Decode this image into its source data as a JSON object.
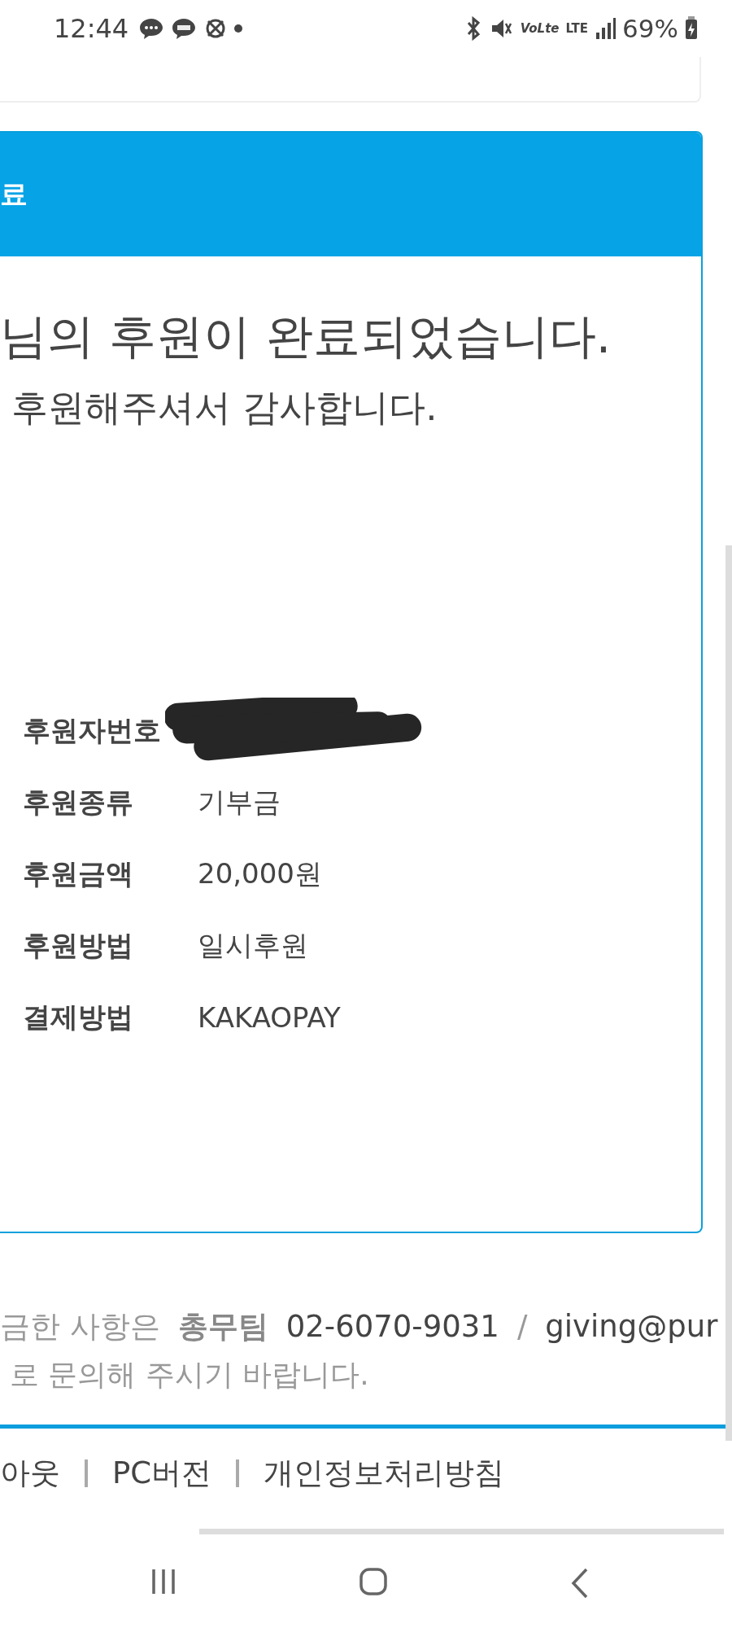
{
  "status_bar": {
    "time": "12:44",
    "battery": "69%",
    "network": "LTE",
    "volte": "VoLte"
  },
  "panel": {
    "heading": "료",
    "message": "님의 후원이 완료되었습니다.",
    "thanks": "후원해주셔서 감사합니다.",
    "rows": [
      {
        "label": "후원자번호",
        "redacted": true
      },
      {
        "label": "후원종류",
        "value": "기부금",
        "redacted": false
      },
      {
        "label": "후원금액",
        "value": "20,000원",
        "redacted": false
      },
      {
        "label": "후원방법",
        "value": "일시후원",
        "redacted": false
      },
      {
        "label": "결제방법",
        "value": "KAKAOPAY",
        "redacted": false
      }
    ]
  },
  "contact": {
    "line_1": [
      {
        "kind": "plain",
        "text": "금한 사항은"
      },
      {
        "kind": "team",
        "text": "총무팀"
      },
      {
        "kind": "strong",
        "text": "02-6070-9031"
      },
      {
        "kind": "plain",
        "text": "/"
      },
      {
        "kind": "strong",
        "text": "giving@pur"
      }
    ],
    "line_2": "로 문의해 주시기 바랍니다."
  },
  "footer_links": [
    "아웃",
    "PC버전",
    "개인정보처리방침"
  ]
}
